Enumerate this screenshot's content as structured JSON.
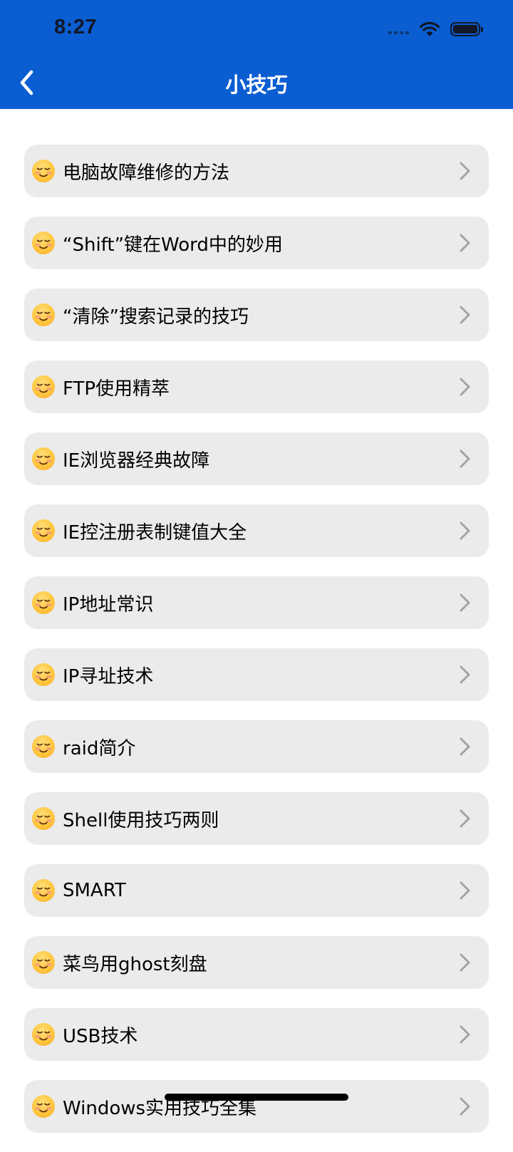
{
  "status_bar": {
    "time": "8:27"
  },
  "nav": {
    "title": "小技巧",
    "back_icon": "chevron-left-icon"
  },
  "colors": {
    "header": "#0A5ED2",
    "item_bg": "#EBEBEB",
    "chevron": "#A3A3A3"
  },
  "items": [
    {
      "label": "电脑故障维修的方法",
      "icon": "smiling-face-icon"
    },
    {
      "label": "“Shift”键在Word中的妙用",
      "icon": "smiling-face-icon"
    },
    {
      "label": "“清除”搜索记录的技巧",
      "icon": "smiling-face-icon"
    },
    {
      "label": "FTP使用精萃",
      "icon": "smiling-face-icon"
    },
    {
      "label": "IE浏览器经典故障",
      "icon": "smiling-face-icon"
    },
    {
      "label": "IE控注册表制键值大全",
      "icon": "smiling-face-icon"
    },
    {
      "label": "IP地址常识",
      "icon": "smiling-face-icon"
    },
    {
      "label": "IP寻址技术",
      "icon": "smiling-face-icon"
    },
    {
      "label": "raid简介",
      "icon": "smiling-face-icon"
    },
    {
      "label": "Shell使用技巧两则",
      "icon": "smiling-face-icon"
    },
    {
      "label": "SMART",
      "icon": "smiling-face-icon"
    },
    {
      "label": "菜鸟用ghost刻盘",
      "icon": "smiling-face-icon"
    },
    {
      "label": "USB技术",
      "icon": "smiling-face-icon"
    },
    {
      "label": "Windows实用技巧全集",
      "icon": "smiling-face-icon"
    }
  ]
}
